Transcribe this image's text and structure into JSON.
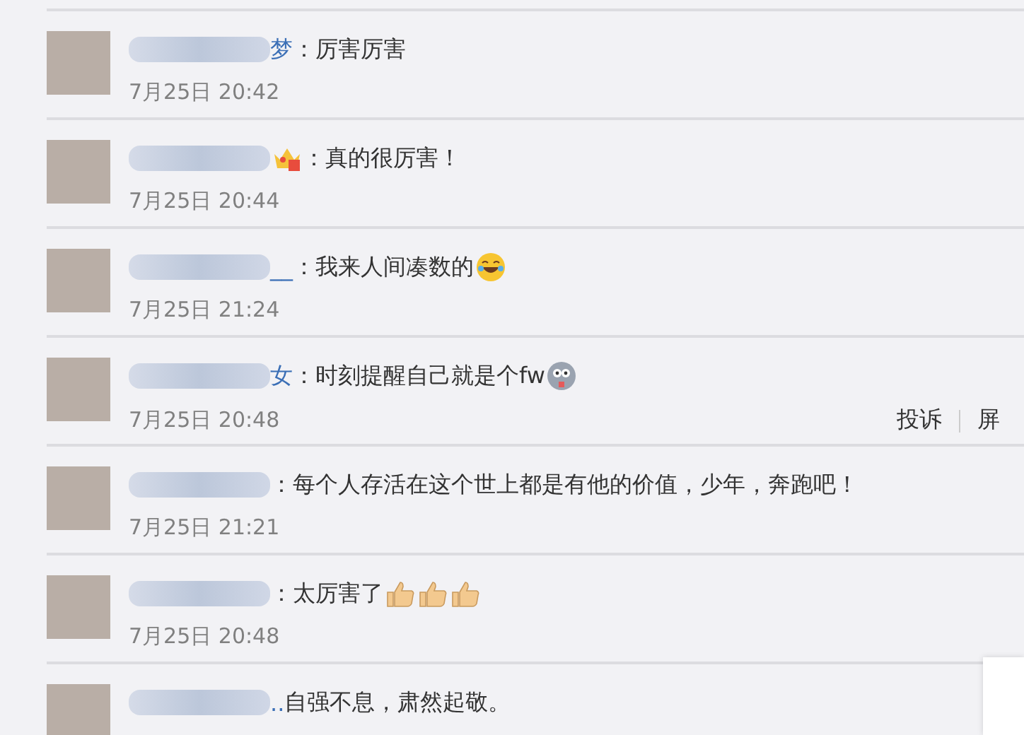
{
  "comments": [
    {
      "name_suffix": "梦",
      "text": "：厉害厉害",
      "time": "7月25日 20:42"
    },
    {
      "badge": true,
      "text": "：真的很厉害！",
      "time": "7月25日 20:44"
    },
    {
      "name_suffix": "__",
      "text": "：我来人间凑数的",
      "emojis": [
        {
          "kind": "laugh-cry"
        }
      ],
      "time": "7月25日 21:24"
    },
    {
      "name_suffix": "女",
      "text": "：时刻提醒自己就是个fw",
      "emojis": [
        {
          "kind": "dog"
        }
      ],
      "time": "7月25日 20:48",
      "actions": [
        "投诉",
        "屏"
      ]
    },
    {
      "text": "：每个人存活在这个世上都是有他的价值，少年，奔跑吧！",
      "time": "7月25日 21:21"
    },
    {
      "text": "：太厉害了",
      "emojis": [
        {
          "kind": "thumbs-up"
        },
        {
          "kind": "thumbs-up"
        },
        {
          "kind": "thumbs-up"
        }
      ],
      "time": "7月25日 20:48"
    },
    {
      "name_suffix": "..",
      "text": " 自强不息，肃然起敬。"
    }
  ]
}
